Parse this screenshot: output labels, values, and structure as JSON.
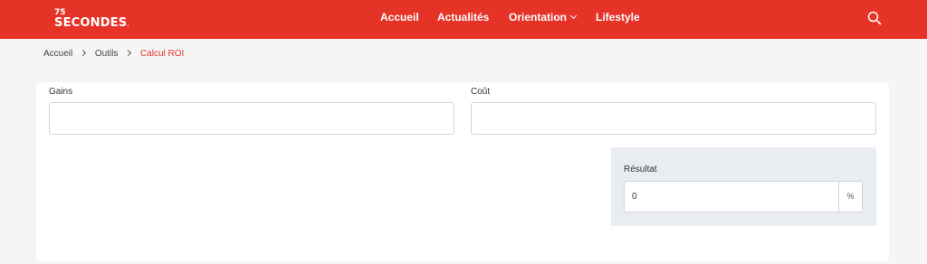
{
  "header": {
    "logo": {
      "number": "75",
      "word": "SECONDES",
      "dot": "."
    },
    "nav": [
      {
        "label": "Accueil"
      },
      {
        "label": "Actualités"
      },
      {
        "label": "Orientation"
      },
      {
        "label": "Lifestyle"
      }
    ],
    "brand_color": "#e53327",
    "search_icon": "search-icon",
    "dropdown_icon": "chevron-down-icon"
  },
  "breadcrumb": {
    "items": [
      "Accueil",
      "Outils",
      "Calcul ROI"
    ],
    "separator_icon": "chevron-right-icon"
  },
  "form": {
    "gains_label": "Gains",
    "gains_value": "",
    "cout_label": "Coût",
    "cout_value": "",
    "result_label": "Résultat",
    "result_value": "0",
    "result_unit": "%"
  }
}
